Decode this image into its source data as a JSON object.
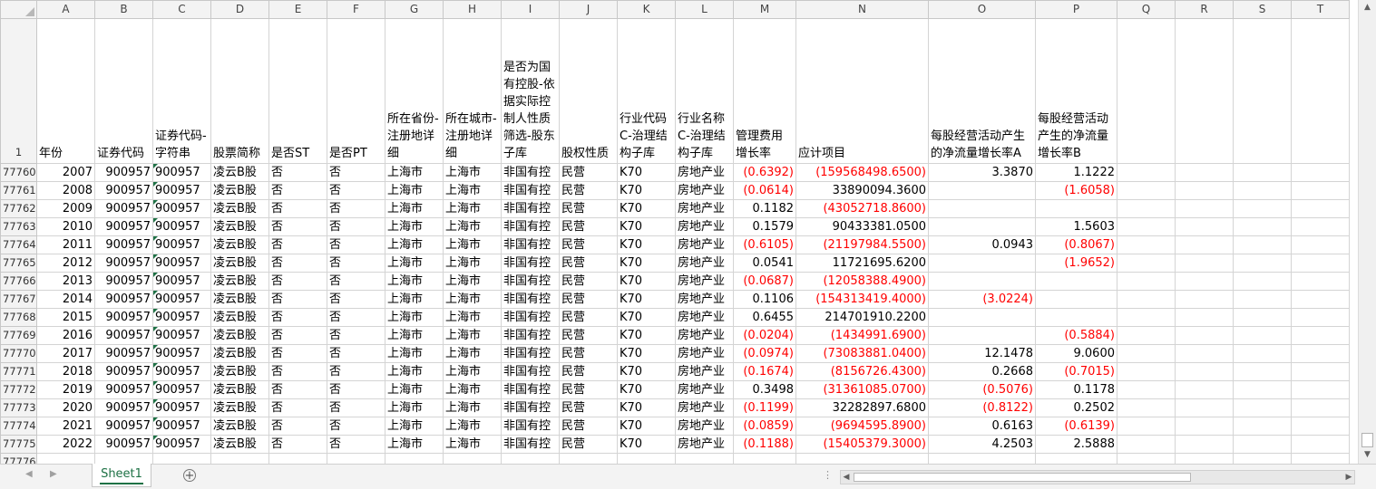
{
  "column_letters": [
    "A",
    "B",
    "C",
    "D",
    "E",
    "F",
    "G",
    "H",
    "I",
    "J",
    "K",
    "L",
    "M",
    "N",
    "O",
    "P",
    "Q",
    "R",
    "S",
    "T"
  ],
  "header_row": {
    "row_number": "1",
    "cells": [
      "年份",
      "证券代码",
      "证券代码-字符串",
      "股票简称",
      "是否ST",
      "是否PT",
      "所在省份-注册地详细",
      "所在城市-注册地详细",
      "是否为国有控股-依据实际控制人性质筛选-股东子库",
      "股权性质",
      "行业代码C-治理结构子库",
      "行业名称C-治理结构子库",
      "管理费用增长率",
      "应计项目",
      "每股经营活动产生的净流量增长率A",
      "每股经营活动产生的净流量增长率B",
      "",
      "",
      "",
      ""
    ]
  },
  "rows": [
    {
      "row_number": "77760",
      "year": "2007",
      "code": "900957",
      "code_str": "900957",
      "name": "凌云B股",
      "is_st": "否",
      "is_pt": "否",
      "province": "上海市",
      "city": "上海市",
      "state_owned": "非国有控",
      "ownership": "民营",
      "industry_code": "K70",
      "industry_name": "房地产业",
      "mgmt_growth": "(0.6392)",
      "accruals": "(159568498.6500)",
      "cfo_growth_a": "3.3870",
      "cfo_growth_b": "1.1222"
    },
    {
      "row_number": "77761",
      "year": "2008",
      "code": "900957",
      "code_str": "900957",
      "name": "凌云B股",
      "is_st": "否",
      "is_pt": "否",
      "province": "上海市",
      "city": "上海市",
      "state_owned": "非国有控",
      "ownership": "民营",
      "industry_code": "K70",
      "industry_name": "房地产业",
      "mgmt_growth": "(0.0614)",
      "accruals": "33890094.3600",
      "cfo_growth_a": "",
      "cfo_growth_b": "(1.6058)"
    },
    {
      "row_number": "77762",
      "year": "2009",
      "code": "900957",
      "code_str": "900957",
      "name": "凌云B股",
      "is_st": "否",
      "is_pt": "否",
      "province": "上海市",
      "city": "上海市",
      "state_owned": "非国有控",
      "ownership": "民营",
      "industry_code": "K70",
      "industry_name": "房地产业",
      "mgmt_growth": "0.1182",
      "accruals": "(43052718.8600)",
      "cfo_growth_a": "",
      "cfo_growth_b": ""
    },
    {
      "row_number": "77763",
      "year": "2010",
      "code": "900957",
      "code_str": "900957",
      "name": "凌云B股",
      "is_st": "否",
      "is_pt": "否",
      "province": "上海市",
      "city": "上海市",
      "state_owned": "非国有控",
      "ownership": "民营",
      "industry_code": "K70",
      "industry_name": "房地产业",
      "mgmt_growth": "0.1579",
      "accruals": "90433381.0500",
      "cfo_growth_a": "",
      "cfo_growth_b": "1.5603"
    },
    {
      "row_number": "77764",
      "year": "2011",
      "code": "900957",
      "code_str": "900957",
      "name": "凌云B股",
      "is_st": "否",
      "is_pt": "否",
      "province": "上海市",
      "city": "上海市",
      "state_owned": "非国有控",
      "ownership": "民营",
      "industry_code": "K70",
      "industry_name": "房地产业",
      "mgmt_growth": "(0.6105)",
      "accruals": "(21197984.5500)",
      "cfo_growth_a": "0.0943",
      "cfo_growth_b": "(0.8067)"
    },
    {
      "row_number": "77765",
      "year": "2012",
      "code": "900957",
      "code_str": "900957",
      "name": "凌云B股",
      "is_st": "否",
      "is_pt": "否",
      "province": "上海市",
      "city": "上海市",
      "state_owned": "非国有控",
      "ownership": "民营",
      "industry_code": "K70",
      "industry_name": "房地产业",
      "mgmt_growth": "0.0541",
      "accruals": "11721695.6200",
      "cfo_growth_a": "",
      "cfo_growth_b": "(1.9652)"
    },
    {
      "row_number": "77766",
      "year": "2013",
      "code": "900957",
      "code_str": "900957",
      "name": "凌云B股",
      "is_st": "否",
      "is_pt": "否",
      "province": "上海市",
      "city": "上海市",
      "state_owned": "非国有控",
      "ownership": "民营",
      "industry_code": "K70",
      "industry_name": "房地产业",
      "mgmt_growth": "(0.0687)",
      "accruals": "(12058388.4900)",
      "cfo_growth_a": "",
      "cfo_growth_b": ""
    },
    {
      "row_number": "77767",
      "year": "2014",
      "code": "900957",
      "code_str": "900957",
      "name": "凌云B股",
      "is_st": "否",
      "is_pt": "否",
      "province": "上海市",
      "city": "上海市",
      "state_owned": "非国有控",
      "ownership": "民营",
      "industry_code": "K70",
      "industry_name": "房地产业",
      "mgmt_growth": "0.1106",
      "accruals": "(154313419.4000)",
      "cfo_growth_a": "(3.0224)",
      "cfo_growth_b": ""
    },
    {
      "row_number": "77768",
      "year": "2015",
      "code": "900957",
      "code_str": "900957",
      "name": "凌云B股",
      "is_st": "否",
      "is_pt": "否",
      "province": "上海市",
      "city": "上海市",
      "state_owned": "非国有控",
      "ownership": "民营",
      "industry_code": "K70",
      "industry_name": "房地产业",
      "mgmt_growth": "0.6455",
      "accruals": "214701910.2200",
      "cfo_growth_a": "",
      "cfo_growth_b": ""
    },
    {
      "row_number": "77769",
      "year": "2016",
      "code": "900957",
      "code_str": "900957",
      "name": "凌云B股",
      "is_st": "否",
      "is_pt": "否",
      "province": "上海市",
      "city": "上海市",
      "state_owned": "非国有控",
      "ownership": "民营",
      "industry_code": "K70",
      "industry_name": "房地产业",
      "mgmt_growth": "(0.0204)",
      "accruals": "(1434991.6900)",
      "cfo_growth_a": "",
      "cfo_growth_b": "(0.5884)"
    },
    {
      "row_number": "77770",
      "year": "2017",
      "code": "900957",
      "code_str": "900957",
      "name": "凌云B股",
      "is_st": "否",
      "is_pt": "否",
      "province": "上海市",
      "city": "上海市",
      "state_owned": "非国有控",
      "ownership": "民营",
      "industry_code": "K70",
      "industry_name": "房地产业",
      "mgmt_growth": "(0.0974)",
      "accruals": "(73083881.0400)",
      "cfo_growth_a": "12.1478",
      "cfo_growth_b": "9.0600"
    },
    {
      "row_number": "77771",
      "year": "2018",
      "code": "900957",
      "code_str": "900957",
      "name": "凌云B股",
      "is_st": "否",
      "is_pt": "否",
      "province": "上海市",
      "city": "上海市",
      "state_owned": "非国有控",
      "ownership": "民营",
      "industry_code": "K70",
      "industry_name": "房地产业",
      "mgmt_growth": "(0.1674)",
      "accruals": "(8156726.4300)",
      "cfo_growth_a": "0.2668",
      "cfo_growth_b": "(0.7015)"
    },
    {
      "row_number": "77772",
      "year": "2019",
      "code": "900957",
      "code_str": "900957",
      "name": "凌云B股",
      "is_st": "否",
      "is_pt": "否",
      "province": "上海市",
      "city": "上海市",
      "state_owned": "非国有控",
      "ownership": "民营",
      "industry_code": "K70",
      "industry_name": "房地产业",
      "mgmt_growth": "0.3498",
      "accruals": "(31361085.0700)",
      "cfo_growth_a": "(0.5076)",
      "cfo_growth_b": "0.1178"
    },
    {
      "row_number": "77773",
      "year": "2020",
      "code": "900957",
      "code_str": "900957",
      "name": "凌云B股",
      "is_st": "否",
      "is_pt": "否",
      "province": "上海市",
      "city": "上海市",
      "state_owned": "非国有控",
      "ownership": "民营",
      "industry_code": "K70",
      "industry_name": "房地产业",
      "mgmt_growth": "(0.1199)",
      "accruals": "32282897.6800",
      "cfo_growth_a": "(0.8122)",
      "cfo_growth_b": "0.2502"
    },
    {
      "row_number": "77774",
      "year": "2021",
      "code": "900957",
      "code_str": "900957",
      "name": "凌云B股",
      "is_st": "否",
      "is_pt": "否",
      "province": "上海市",
      "city": "上海市",
      "state_owned": "非国有控",
      "ownership": "民营",
      "industry_code": "K70",
      "industry_name": "房地产业",
      "mgmt_growth": "(0.0859)",
      "accruals": "(9694595.8900)",
      "cfo_growth_a": "0.6163",
      "cfo_growth_b": "(0.6139)"
    },
    {
      "row_number": "77775",
      "year": "2022",
      "code": "900957",
      "code_str": "900957",
      "name": "凌云B股",
      "is_st": "否",
      "is_pt": "否",
      "province": "上海市",
      "city": "上海市",
      "state_owned": "非国有控",
      "ownership": "民营",
      "industry_code": "K70",
      "industry_name": "房地产业",
      "mgmt_growth": "(0.1188)",
      "accruals": "(15405379.3000)",
      "cfo_growth_a": "4.2503",
      "cfo_growth_b": "2.5888"
    }
  ],
  "empty_row_number": "77776",
  "sheet_tabs": [
    {
      "label": "Sheet1",
      "active": true
    }
  ],
  "icons": {
    "add_sheet": "plus-circle-icon",
    "nav_prev": "triangle-left-icon",
    "nav_next": "triangle-right-icon",
    "scroll_up": "triangle-up-icon",
    "scroll_down": "triangle-down-icon"
  },
  "colors": {
    "negative": "#ff0000",
    "accent": "#1e7145"
  }
}
